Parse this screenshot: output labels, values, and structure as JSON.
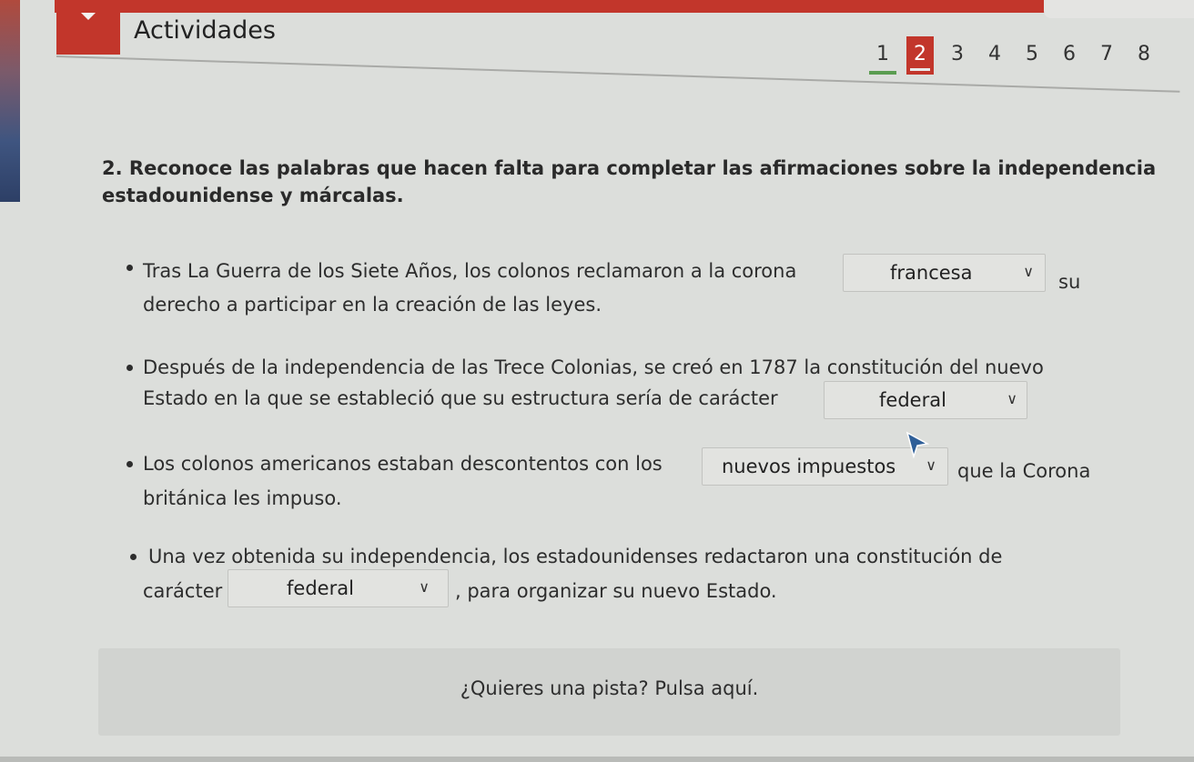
{
  "header": {
    "title": "Actividades",
    "pages": [
      "1",
      "2",
      "3",
      "4",
      "5",
      "6",
      "7",
      "8"
    ],
    "current_page": "2"
  },
  "question": {
    "text": "2. Reconoce las palabras que hacen falta para completar las afirmaciones sobre la independencia estadounidense y márcalas."
  },
  "items": [
    {
      "line1_before": "Tras La Guerra de los Siete Años, los colonos reclamaron a la corona",
      "select_value": "francesa",
      "line1_after": "su",
      "line2": "derecho a participar en la creación de las leyes."
    },
    {
      "line1": "Después de la independencia de las Trece Colonias, se creó en 1787 la constitución del nuevo",
      "line2_before": "Estado en la que se estableció que su estructura sería de carácter",
      "select_value": "federal"
    },
    {
      "line1_before": "Los colonos americanos estaban descontentos con los",
      "select_value": "nuevos impuestos",
      "line1_after": "que la Corona",
      "line2": "británica les impuso."
    },
    {
      "line1": "Una vez obtenida su independencia, los estadounidenses redactaron una constitución de",
      "line2_before": "carácter",
      "select_value": "federal",
      "line2_after": ", para organizar su nuevo Estado."
    }
  ],
  "hint": {
    "label": "¿Quieres una pista? Pulsa aquí."
  },
  "icons": {
    "dropdown": "chevron-down-icon",
    "menu": "triangle-down-icon",
    "pointer": "cursor-icon"
  },
  "colors": {
    "accent": "#c2362b",
    "completed": "#5b9d51",
    "background": "#dcdedb"
  }
}
